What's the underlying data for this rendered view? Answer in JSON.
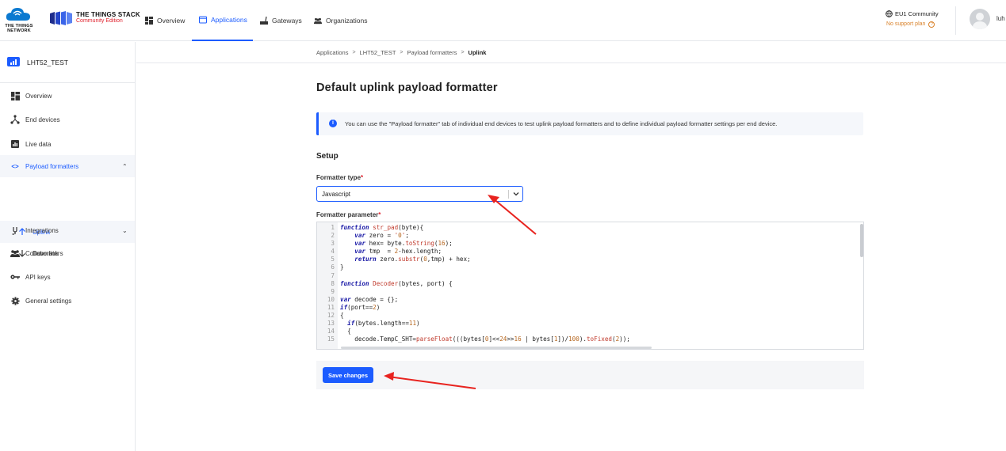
{
  "brand": {
    "ttn_text_line1": "THE THINGS",
    "ttn_text_line2": "NETWORK",
    "stack_title": "THE THINGS STACK",
    "stack_subtitle": "Community Edition"
  },
  "topnav": {
    "items": [
      {
        "label": "Overview",
        "icon": "dashboard-icon"
      },
      {
        "label": "Applications",
        "icon": "applications-icon",
        "active": true
      },
      {
        "label": "Gateways",
        "icon": "gateway-icon"
      },
      {
        "label": "Organizations",
        "icon": "organizations-icon"
      }
    ]
  },
  "account": {
    "region": "EU1 Community",
    "support": "No support plan",
    "username": "luh"
  },
  "sidebar": {
    "app_name": "LHT52_TEST",
    "items": [
      {
        "label": "Overview",
        "icon": "dashboard-icon"
      },
      {
        "label": "End devices",
        "icon": "end-devices-icon"
      },
      {
        "label": "Live data",
        "icon": "live-data-icon"
      },
      {
        "label": "Payload formatters",
        "icon": "code-icon",
        "active": true
      },
      {
        "label": "Uplink",
        "icon": "arrow-up-icon"
      },
      {
        "label": "Downlink",
        "icon": "arrow-down-icon"
      },
      {
        "label": "Integrations",
        "icon": "integrations-icon"
      },
      {
        "label": "Collaborators",
        "icon": "collaborators-icon"
      },
      {
        "label": "API keys",
        "icon": "key-icon"
      },
      {
        "label": "General settings",
        "icon": "gear-icon"
      }
    ]
  },
  "breadcrumb": [
    "Applications",
    "LHT52_TEST",
    "Payload formatters",
    "Uplink"
  ],
  "main": {
    "title": "Default uplink payload formatter",
    "notice": "You can use the \"Payload formatter\" tab of individual end devices to test uplink payload formatters and to define individual payload formatter settings per end device.",
    "setup_title": "Setup",
    "formatter_type_label": "Formatter type",
    "formatter_type_value": "Javascript",
    "formatter_param_label": "Formatter parameter",
    "required_mark": "*",
    "save_label": "Save changes"
  },
  "code_lines": [
    {
      "n": "1",
      "text": "function str_pad(byte){"
    },
    {
      "n": "2",
      "text": "    var zero = '0';"
    },
    {
      "n": "3",
      "text": "    var hex= byte.toString(16);"
    },
    {
      "n": "4",
      "text": "    var tmp  = 2-hex.length;"
    },
    {
      "n": "5",
      "text": "    return zero.substr(0,tmp) + hex;"
    },
    {
      "n": "6",
      "text": "}"
    },
    {
      "n": "7",
      "text": ""
    },
    {
      "n": "8",
      "text": "function Decoder(bytes, port) {"
    },
    {
      "n": "9",
      "text": ""
    },
    {
      "n": "10",
      "text": "var decode = {};"
    },
    {
      "n": "11",
      "text": "if(port==2)"
    },
    {
      "n": "12",
      "text": "{"
    },
    {
      "n": "13",
      "text": "  if(bytes.length==11)"
    },
    {
      "n": "14",
      "text": "  {"
    },
    {
      "n": "15",
      "text": "    decode.TempC_SHT=parseFloat(((bytes[0]<<24>>16 | bytes[1])/100).toFixed(2));"
    }
  ]
}
